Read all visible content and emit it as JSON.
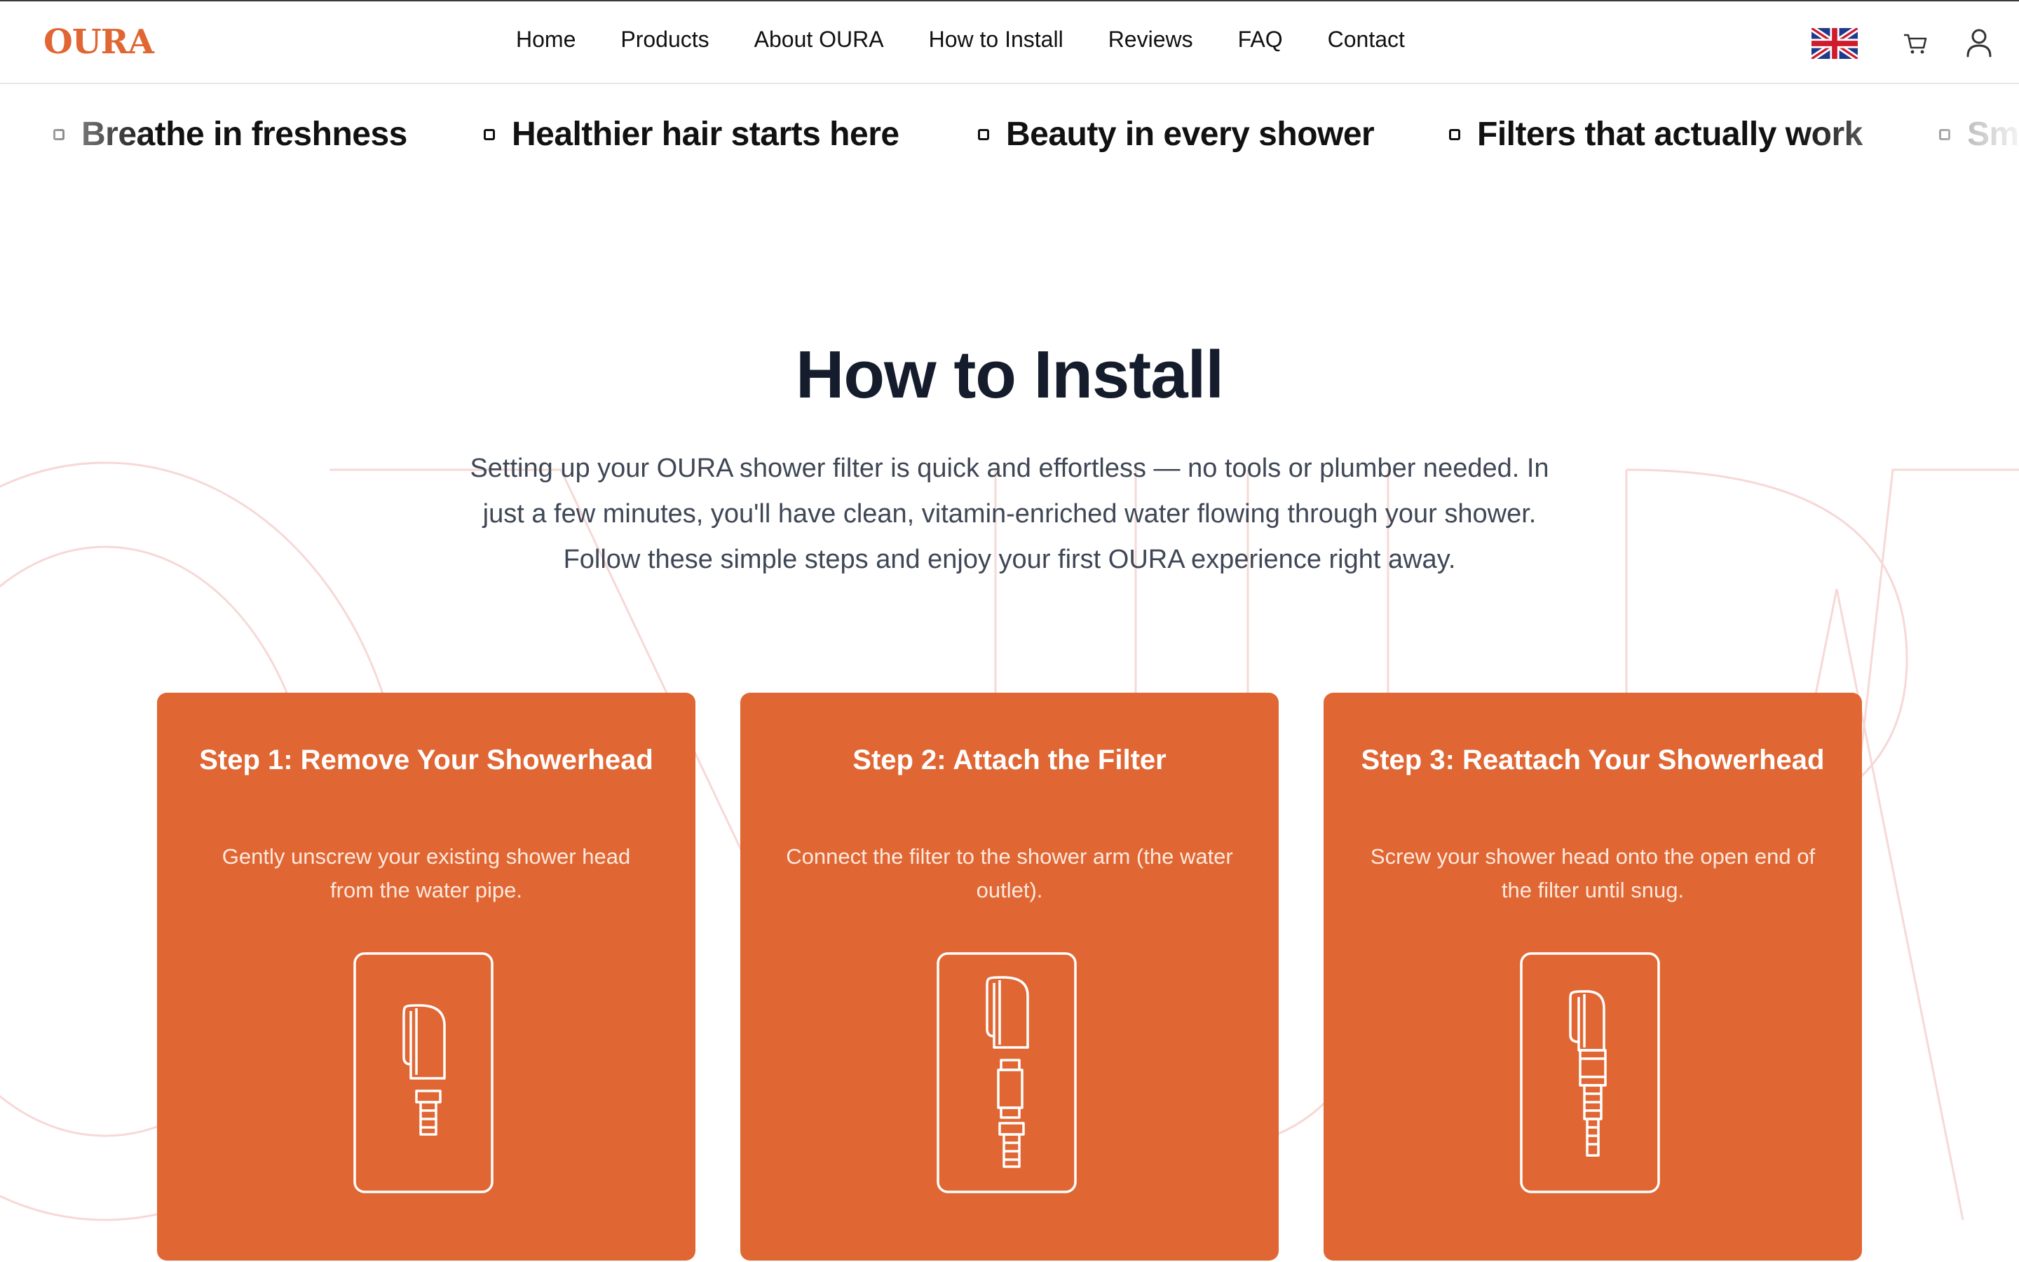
{
  "brand": {
    "logo_text": "OURA",
    "accent_color": "#e06633"
  },
  "nav": {
    "items": [
      "Home",
      "Products",
      "About OURA",
      "How to Install",
      "Reviews",
      "FAQ",
      "Contact"
    ]
  },
  "header_icons": {
    "language": "uk-flag-icon",
    "cart": "cart-icon",
    "account": "user-icon"
  },
  "marquee": {
    "items": [
      "Breathe in freshness",
      "Healthier hair starts here",
      "Beauty in every shower",
      "Filters that actually work",
      "Sm"
    ]
  },
  "main": {
    "title": "How to Install",
    "intro": "Setting up your OURA shower filter is quick and effortless — no tools or plumber needed. In just a few minutes, you'll have clean, vitamin-enriched water flowing through your shower. Follow these simple steps and enjoy your first OURA experience right away."
  },
  "steps": [
    {
      "title": "Step 1: Remove Your Showerhead",
      "description": "Gently unscrew your existing shower head from the water pipe.",
      "icon": "showerhead-removed-icon"
    },
    {
      "title": "Step 2: Attach the Filter",
      "description": "Connect the filter to the shower arm (the water outlet).",
      "icon": "filter-attach-icon"
    },
    {
      "title": "Step 3: Reattach Your Showerhead",
      "description": "Screw your shower head onto the open end of the filter until snug.",
      "icon": "showerhead-reattach-icon"
    }
  ]
}
